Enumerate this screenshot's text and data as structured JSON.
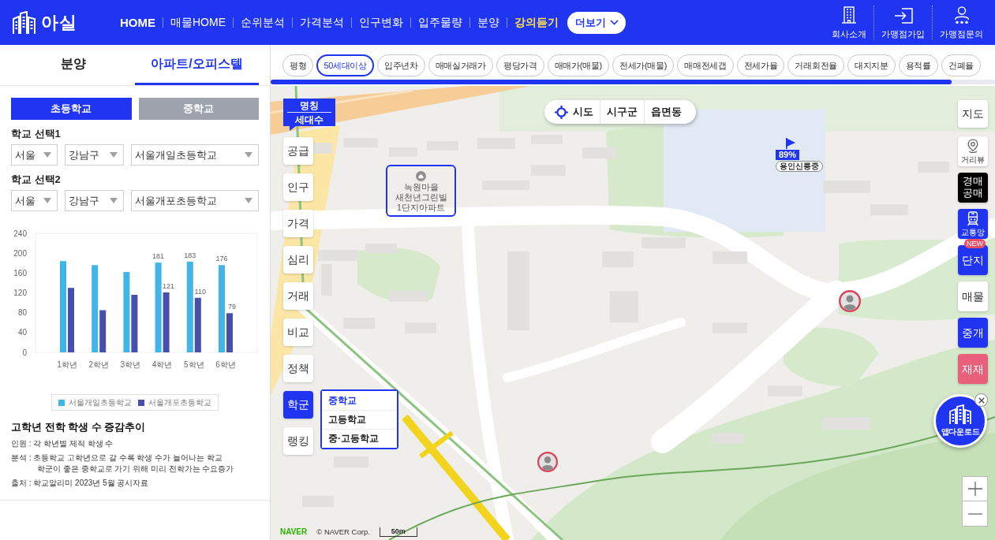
{
  "header": {
    "logo": "아실",
    "nav": [
      {
        "label": "HOME",
        "kind": "home"
      },
      {
        "label": "매물HOME",
        "kind": "link"
      },
      {
        "label": "순위분석",
        "kind": "link"
      },
      {
        "label": "가격분석",
        "kind": "link"
      },
      {
        "label": "인구변화",
        "kind": "link"
      },
      {
        "label": "입주물량",
        "kind": "link"
      },
      {
        "label": "분양",
        "kind": "link"
      },
      {
        "label": "강의듣기",
        "kind": "promo"
      }
    ],
    "more_button": "더보기",
    "actions": [
      "회사소개",
      "가맹점가입",
      "가맹점문의"
    ]
  },
  "left_panel": {
    "tabs": [
      {
        "label": "분양",
        "selected": false
      },
      {
        "label": "아파트/오피스텔",
        "selected": true
      }
    ],
    "school_levels": [
      {
        "label": "초등학교",
        "selected": true
      },
      {
        "label": "중학교",
        "selected": false
      }
    ],
    "school_selects": [
      {
        "label": "학교 선택1",
        "fields": [
          "서울",
          "강남구",
          "서울개일초등학교"
        ]
      },
      {
        "label": "학교 선택2",
        "fields": [
          "서울",
          "강남구",
          "서울개포초등학교"
        ]
      }
    ],
    "chart_data": {
      "type": "bar",
      "categories": [
        "1학년",
        "2학년",
        "3학년",
        "4학년",
        "5학년",
        "6학년"
      ],
      "series": [
        {
          "name": "서울개일초등학교",
          "color": "#41b4e8",
          "values": [
            184,
            176,
            162,
            181,
            183,
            176
          ]
        },
        {
          "name": "서울개포초등학교",
          "color": "#4650ac",
          "values": [
            130,
            85,
            116,
            121,
            110,
            79
          ]
        }
      ],
      "ylim": [
        0,
        240
      ],
      "yticks": [
        0,
        40,
        80,
        120,
        160,
        200,
        240
      ],
      "value_labels": [
        [
          null,
          null,
          null,
          "181",
          "183",
          "176"
        ],
        [
          null,
          null,
          null,
          "121",
          "110",
          "79"
        ]
      ]
    },
    "notes_title": "고학년 전학 학생 수 증감추이",
    "notes": [
      {
        "lines": [
          "인원 : 각 학년별 제적 학생 수"
        ]
      },
      {
        "lines": [
          "분석 : 초등학교 고학년으로 갈 수록 학생 수가 늘어나는 학교",
          "학군이 좋은 중학교로 가기 위해 미리 전학가는 수요증가"
        ]
      },
      {
        "lines": [
          "출처 : 학교알리미 2023년 5월 공시자료"
        ]
      }
    ]
  },
  "map": {
    "filters": [
      {
        "label": "평형",
        "selected": false
      },
      {
        "label": "50세대이상",
        "selected": true
      },
      {
        "label": "입주년차",
        "selected": false
      },
      {
        "label": "매매실거래가",
        "selected": false
      },
      {
        "label": "평당가격",
        "selected": false
      },
      {
        "label": "매매가(매물)",
        "selected": false
      },
      {
        "label": "전세가(매물)",
        "selected": false
      },
      {
        "label": "매매전세갭",
        "selected": false
      },
      {
        "label": "전세가율",
        "selected": false
      },
      {
        "label": "거래회전율",
        "selected": false
      },
      {
        "label": "대지지분",
        "selected": false
      },
      {
        "label": "용적률",
        "selected": false
      },
      {
        "label": "건폐율",
        "selected": false
      }
    ],
    "name_toggle": [
      "명칭",
      "세대수"
    ],
    "region_levels": [
      "시도",
      "시구군",
      "읍면동"
    ],
    "left_menu": [
      {
        "label": "공급",
        "selected": false
      },
      {
        "label": "인구",
        "selected": false
      },
      {
        "label": "가격",
        "selected": false
      },
      {
        "label": "심리",
        "selected": false
      },
      {
        "label": "거래",
        "selected": false
      },
      {
        "label": "비교",
        "selected": false
      },
      {
        "label": "정책",
        "selected": false
      },
      {
        "label": "학군",
        "selected": true
      },
      {
        "label": "랭킹",
        "selected": false
      }
    ],
    "school_dropdown": [
      {
        "label": "중학교",
        "selected": true
      },
      {
        "label": "고등학교",
        "selected": false
      },
      {
        "label": "중·고등학교",
        "selected": false
      }
    ],
    "right_menu": [
      {
        "label": "지도",
        "kind": "plain"
      },
      {
        "label": "거리뷰",
        "kind": "streetview"
      },
      {
        "label": "경매 공매",
        "kind": "dark"
      },
      {
        "label": "교통망",
        "kind": "transit"
      },
      {
        "label": "단지",
        "kind": "primary",
        "badge": "NEW"
      },
      {
        "label": "매물",
        "kind": "plain"
      },
      {
        "label": "중개",
        "kind": "primary"
      },
      {
        "label": "재재",
        "kind": "alert"
      }
    ],
    "highlighted_complex": "녹원마을 새천년그린빌 1단지아파트",
    "school_marker": {
      "percent": "89%",
      "name": "용인신릉중"
    },
    "app_download": "앱다운로드",
    "attribution": {
      "logo": "NAVER",
      "copyright": "© NAVER Corp.",
      "scale": "50m"
    }
  }
}
